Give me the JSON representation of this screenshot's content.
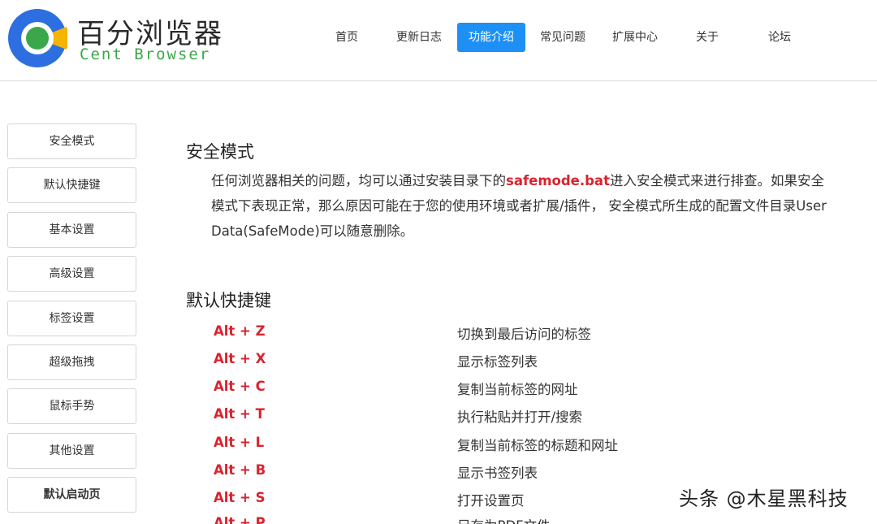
{
  "brand": {
    "name_cn": "百分浏览器",
    "name_en": "Cent Browser",
    "colors": {
      "blue": "#2d6fe0",
      "green": "#3aa84a",
      "yellow": "#f5b400",
      "accent": "#1e90f5",
      "highlight": "#d9232e"
    }
  },
  "nav": {
    "items": [
      {
        "label": "首页"
      },
      {
        "label": "更新日志"
      },
      {
        "label": "功能介绍",
        "active": true
      },
      {
        "label": "常见问题"
      },
      {
        "label": "扩展中心"
      },
      {
        "label": "关于"
      },
      {
        "label": "论坛"
      }
    ]
  },
  "sidebar": {
    "items": [
      {
        "label": "安全模式"
      },
      {
        "label": "默认快捷键"
      },
      {
        "label": "基本设置"
      },
      {
        "label": "高级设置"
      },
      {
        "label": "标签设置"
      },
      {
        "label": "超级拖拽"
      },
      {
        "label": "鼠标手势"
      },
      {
        "label": "其他设置"
      },
      {
        "label": "默认启动页"
      }
    ]
  },
  "safe_mode": {
    "title": "安全模式",
    "text_before": "任何浏览器相关的问题，均可以通过安装目录下的",
    "highlight": "safemode.bat",
    "text_after": "进入安全模式来进行排查。如果安全模式下表现正常，那么原因可能在于您的使用环境或者扩展/插件， 安全模式所生成的配置文件目录User Data(SafeMode)可以随意删除。"
  },
  "shortcuts": {
    "title": "默认快捷键",
    "rows": [
      {
        "key": "Alt + Z",
        "desc": "切换到最后访问的标签"
      },
      {
        "key": "Alt + X",
        "desc": "显示标签列表"
      },
      {
        "key": "Alt + C",
        "desc": "复制当前标签的网址"
      },
      {
        "key": "Alt + T",
        "desc": "执行粘贴并打开/搜索"
      },
      {
        "key": "Alt + L",
        "desc": "复制当前标签的标题和网址"
      },
      {
        "key": "Alt + B",
        "desc": "显示书签列表"
      },
      {
        "key": "Alt + S",
        "desc": "打开设置页"
      },
      {
        "key": "Alt + P",
        "desc": "另存为PDF文件"
      }
    ]
  },
  "watermark": "头条 @木星黑科技"
}
